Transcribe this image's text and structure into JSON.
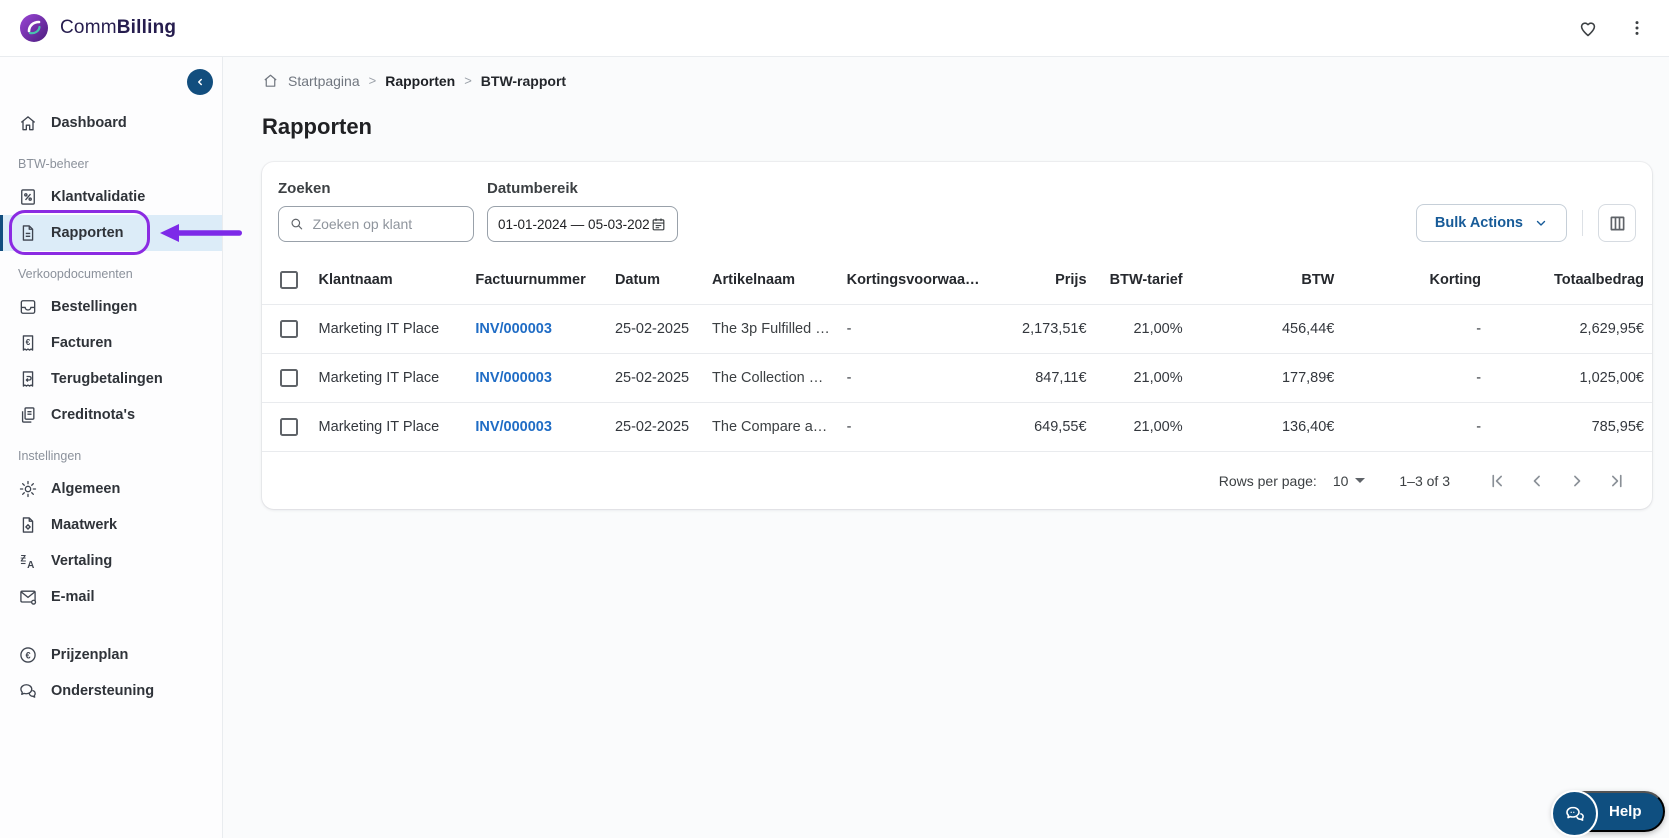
{
  "brand": {
    "prefix": "Comm",
    "suffix": "Billing",
    "logo_icon": "swirl-logo"
  },
  "topbar": {
    "icons": [
      "heart-icon",
      "kebab-menu-icon"
    ]
  },
  "sidebar": {
    "collapse_icon": "chevron-left-icon",
    "sections": [
      {
        "label": "",
        "items": [
          {
            "label": "Dashboard",
            "icon": "home-icon",
            "selected": false
          }
        ]
      },
      {
        "label": "BTW-beheer",
        "items": [
          {
            "label": "Klantvalidatie",
            "icon": "percent-document-icon",
            "selected": false
          },
          {
            "label": "Rapporten",
            "icon": "report-document-icon",
            "selected": true,
            "annotated": true
          }
        ]
      },
      {
        "label": "Verkoopdocumenten",
        "items": [
          {
            "label": "Bestellingen",
            "icon": "inbox-icon",
            "selected": false
          },
          {
            "label": "Facturen",
            "icon": "receipt-euro-icon",
            "selected": false
          },
          {
            "label": "Terugbetalingen",
            "icon": "refund-receipt-icon",
            "selected": false
          },
          {
            "label": "Creditnota's",
            "icon": "copy-documents-icon",
            "selected": false
          }
        ]
      },
      {
        "label": "Instellingen",
        "items": [
          {
            "label": "Algemeen",
            "icon": "gear-icon",
            "selected": false
          },
          {
            "label": "Maatwerk",
            "icon": "document-gear-icon",
            "selected": false
          },
          {
            "label": "Vertaling",
            "icon": "translate-icon",
            "selected": false
          },
          {
            "label": "E-mail",
            "icon": "mail-gear-icon",
            "selected": false
          }
        ]
      },
      {
        "label": "",
        "items": [
          {
            "label": "Prijzenplan",
            "icon": "euro-circle-icon",
            "selected": false
          },
          {
            "label": "Ondersteuning",
            "icon": "support-chat-icon",
            "selected": false
          }
        ]
      }
    ]
  },
  "breadcrumb": {
    "home_icon": "home-icon",
    "items": [
      "Startpagina",
      "Rapporten",
      "BTW-rapport"
    ]
  },
  "page": {
    "title": "Rapporten"
  },
  "filters": {
    "search_label": "Zoeken",
    "search_placeholder": "Zoeken op klant",
    "search_icon": "search-icon",
    "date_label": "Datumbereik",
    "date_value": "01-01-2024 — 05-03-202",
    "date_icon": "calendar-icon",
    "bulk_actions_label": "Bulk Actions",
    "columns_button_icon": "view-columns-icon"
  },
  "table": {
    "columns": [
      "Klantnaam",
      "Factuurnummer",
      "Datum",
      "Artikelnaam",
      "Kortingsvoorwaar…",
      "Prijs",
      "BTW-tarief",
      "BTW",
      "Korting",
      "Totaalbedrag"
    ],
    "rows": [
      {
        "klantnaam": "Marketing IT Place",
        "factuurnummer": "INV/000003",
        "datum": "25-02-2025",
        "artikelnaam": "The 3p Fulfilled S…",
        "kortingsvoorwaarden": "-",
        "prijs": "2,173,51€",
        "btw_tarief": "21,00%",
        "btw": "456,44€",
        "korting": "-",
        "totaalbedrag": "2,629,95€"
      },
      {
        "klantnaam": "Marketing IT Place",
        "factuurnummer": "INV/000003",
        "datum": "25-02-2025",
        "artikelnaam": "The Collection Sn…",
        "kortingsvoorwaarden": "-",
        "prijs": "847,11€",
        "btw_tarief": "21,00%",
        "btw": "177,89€",
        "korting": "-",
        "totaalbedrag": "1,025,00€"
      },
      {
        "klantnaam": "Marketing IT Place",
        "factuurnummer": "INV/000003",
        "datum": "25-02-2025",
        "artikelnaam": "The Compare at …",
        "kortingsvoorwaarden": "-",
        "prijs": "649,55€",
        "btw_tarief": "21,00%",
        "btw": "136,40€",
        "korting": "-",
        "totaalbedrag": "785,95€"
      }
    ]
  },
  "pagination": {
    "rows_per_page_label": "Rows per page:",
    "rows_per_page_value": "10",
    "range": "1–3 of 3",
    "nav_icons": [
      "first-page-icon",
      "prev-page-icon",
      "next-page-icon",
      "last-page-icon"
    ]
  },
  "help": {
    "label": "Help",
    "icon": "support-chat-icon"
  },
  "colors": {
    "annotation_purple": "#8b2be2",
    "navy": "#0f4f80",
    "link_blue": "#1f6cc5",
    "selected_item_bg": "#dcecf8",
    "bulk_button_text": "#175b98"
  }
}
